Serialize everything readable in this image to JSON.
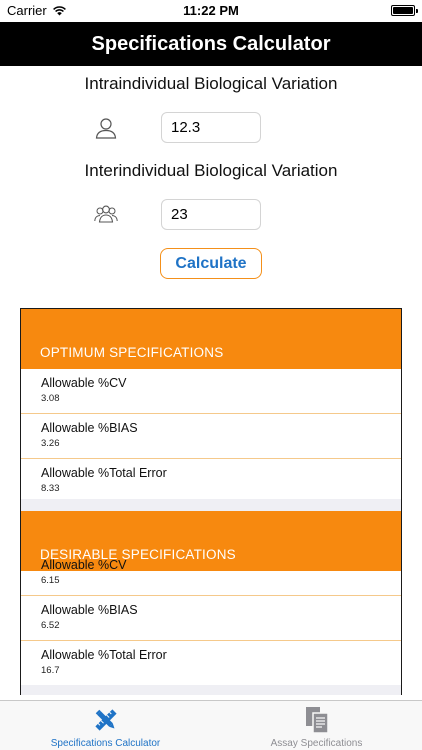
{
  "status": {
    "carrier": "Carrier",
    "time": "11:22 PM"
  },
  "nav": {
    "title": "Specifications Calculator"
  },
  "intra": {
    "label": "Intraindividual Biological Variation",
    "value": "12.3",
    "icon": "person-icon"
  },
  "inter": {
    "label": "Interindividual Biological Variation",
    "value": "23",
    "icon": "group-icon"
  },
  "calculate": {
    "label": "Calculate"
  },
  "optimum": {
    "header": "OPTIMUM SPECIFICATIONS",
    "rows": [
      {
        "label": "Allowable %CV",
        "value": "3.08"
      },
      {
        "label": "Allowable %BIAS",
        "value": "3.26"
      },
      {
        "label": "Allowable %Total Error",
        "value": "8.33"
      }
    ]
  },
  "desirable": {
    "header": "DESIRABLE SPECIFICATIONS",
    "rows": [
      {
        "label": "Allowable %CV",
        "value": "6.15"
      },
      {
        "label": "Allowable %BIAS",
        "value": "6.52"
      },
      {
        "label": "Allowable %Total Error",
        "value": "16.7"
      }
    ]
  },
  "tabs": [
    {
      "label": "Specifications Calculator",
      "icon": "ruler-pencil-icon",
      "active": true
    },
    {
      "label": "Assay Specifications",
      "icon": "documents-icon",
      "active": false
    }
  ],
  "colors": {
    "accent": "#f7890f",
    "tint": "#1f73c6",
    "inactive": "#8e8e93",
    "navbar": "#000000"
  }
}
